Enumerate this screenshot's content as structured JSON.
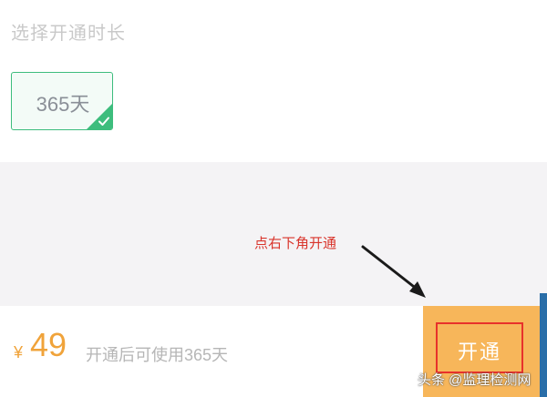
{
  "section": {
    "title": "选择开通时长"
  },
  "options": [
    {
      "label": "365天",
      "selected": true
    }
  ],
  "annotation": {
    "text": "点右下角开通"
  },
  "footer": {
    "currency": "¥",
    "price": "49",
    "note": "开通后可使用365天",
    "button_label": "开通"
  },
  "watermark": {
    "text": "头条 @监理检测网"
  },
  "colors": {
    "accent_green": "#3dbd7d",
    "price_orange": "#f0a33a",
    "button_orange": "#f7b65a",
    "annotation_red": "#d9342b"
  },
  "icons": {
    "selected_check": "check-icon"
  }
}
